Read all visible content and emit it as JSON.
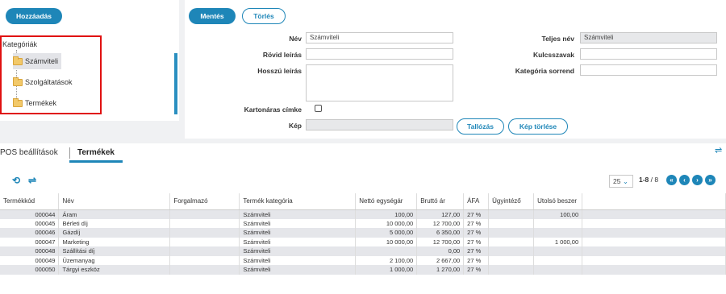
{
  "left": {
    "add_button": "Hozzáadás",
    "tree_root": "Kategóriák",
    "tree_items": [
      "Számviteli",
      "Szolgáltatások",
      "Termékek"
    ]
  },
  "form": {
    "save_button": "Mentés",
    "delete_button": "Törlés",
    "name_label": "Név",
    "name_value": "Számviteli",
    "full_name_label": "Teljes név",
    "full_name_value": "Számviteli",
    "short_desc_label": "Rövid leírás",
    "short_desc_value": "",
    "keywords_label": "Kulcsszavak",
    "keywords_value": "",
    "long_desc_label": "Hosszú leírás",
    "long_desc_value": "",
    "category_order_label": "Kategória sorrend",
    "category_order_value": "",
    "card_label_label": "Kartonáras címke",
    "image_label": "Kép",
    "browse_button": "Tallózás",
    "delete_image_button": "Kép törlése"
  },
  "tabs": [
    "POS beállítások",
    "Termékek"
  ],
  "pager": {
    "page_size": "25",
    "range": "1-8",
    "total": "/ 8"
  },
  "grid": {
    "headers": [
      "Termékkód",
      "Név",
      "Forgalmazó",
      "Termék kategória",
      "Nettó egységár",
      "Bruttó ár",
      "ÁFA",
      "Ügyintéző",
      "Utolsó beszer"
    ],
    "rows": [
      [
        "000044",
        "Áram",
        "",
        "Számviteli",
        "100,00",
        "127,00",
        "27 %",
        "",
        "100,00"
      ],
      [
        "000045",
        "Bérleti díj",
        "",
        "Számviteli",
        "10 000,00",
        "12 700,00",
        "27 %",
        "",
        ""
      ],
      [
        "000046",
        "Gázdíj",
        "",
        "Számviteli",
        "5 000,00",
        "6 350,00",
        "27 %",
        "",
        ""
      ],
      [
        "000047",
        "Marketing",
        "",
        "Számviteli",
        "10 000,00",
        "12 700,00",
        "27 %",
        "",
        "1 000,00"
      ],
      [
        "000048",
        "Szállítási díj",
        "",
        "Számviteli",
        "",
        "0,00",
        "27 %",
        "",
        ""
      ],
      [
        "000049",
        "Üzemanyag",
        "",
        "Számviteli",
        "2 100,00",
        "2 667,00",
        "27 %",
        "",
        ""
      ],
      [
        "000050",
        "Tárgyi eszköz",
        "",
        "Számviteli",
        "1 000,00",
        "1 270,00",
        "27 %",
        "",
        ""
      ]
    ]
  },
  "colors": {
    "accent": "#1e86b8",
    "highlight_box": "#e01010",
    "row_stripe": "#e5e6ea"
  }
}
